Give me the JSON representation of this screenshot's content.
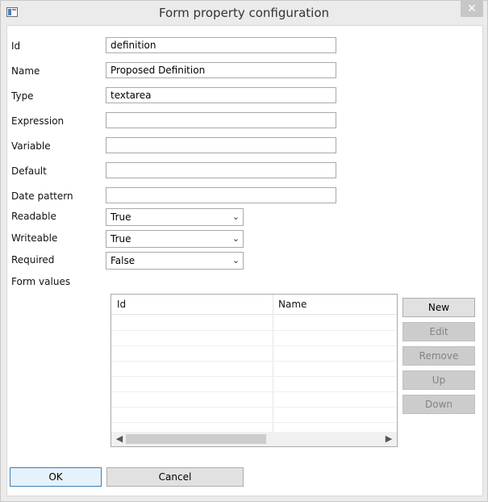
{
  "window": {
    "title": "Form property configuration",
    "close_glyph": "✕",
    "icon": "window-icon"
  },
  "fields": {
    "id": {
      "label": "Id",
      "value": "definition"
    },
    "name": {
      "label": "Name",
      "value": "Proposed Definition"
    },
    "type": {
      "label": "Type",
      "value": "textarea"
    },
    "expression": {
      "label": "Expression",
      "value": ""
    },
    "variable": {
      "label": "Variable",
      "value": ""
    },
    "default": {
      "label": "Default",
      "value": ""
    },
    "date_pattern": {
      "label": "Date pattern",
      "value": ""
    }
  },
  "selects": {
    "readable": {
      "label": "Readable",
      "value": "True"
    },
    "writeable": {
      "label": "Writeable",
      "value": "True"
    },
    "required": {
      "label": "Required",
      "value": "False"
    }
  },
  "form_values": {
    "label": "Form values",
    "columns": [
      "Id",
      "Name"
    ],
    "rows": []
  },
  "side_buttons": {
    "new": "New",
    "edit": "Edit",
    "remove": "Remove",
    "up": "Up",
    "down": "Down"
  },
  "footer": {
    "ok": "OK",
    "cancel": "Cancel"
  }
}
